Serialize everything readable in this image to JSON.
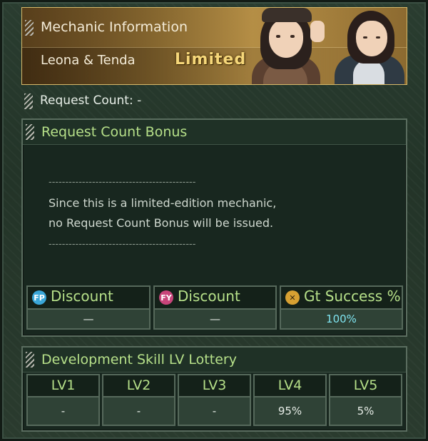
{
  "header": {
    "section_title": "Mechanic Information",
    "mechanic_name": "Leona & Tenda",
    "badge": "Limited"
  },
  "request_count": {
    "label": "Request Count: -"
  },
  "bonus_panel": {
    "title": "Request Count Bonus",
    "divider": "--------------------------------------------",
    "notice_line1": "Since this is a limited-edition mechanic,",
    "notice_line2": "no Request Count Bonus will be issued.",
    "stats": [
      {
        "label": "Discount",
        "value": "—",
        "icon": "fp-coin-icon",
        "icon_text": "FP",
        "icon_color": "#3aa6d8"
      },
      {
        "label": "Discount",
        "value": "—",
        "icon": "fy-coin-icon",
        "icon_text": "FY",
        "icon_color": "#c8457a"
      },
      {
        "label": "Gt Success %",
        "value": "100%",
        "icon": "wrench-hammer-icon",
        "icon_text": "✕",
        "icon_color": "#d7a032"
      }
    ],
    "success_value_color": "#7fe3ef"
  },
  "lottery_panel": {
    "title": "Development Skill LV Lottery",
    "levels": [
      {
        "label": "LV1",
        "value": "-"
      },
      {
        "label": "LV2",
        "value": "-"
      },
      {
        "label": "LV3",
        "value": "-"
      },
      {
        "label": "LV4",
        "value": "95%"
      },
      {
        "label": "LV5",
        "value": "5%"
      }
    ]
  }
}
